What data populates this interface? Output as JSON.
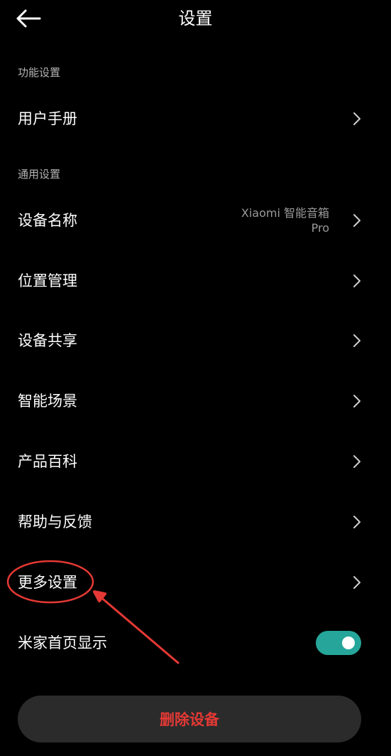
{
  "header": {
    "title": "设置",
    "back_icon": "arrow-left-icon"
  },
  "sections": {
    "function_label": "功能设置",
    "general_label": "通用设置"
  },
  "items": {
    "user_manual": "用户手册",
    "device_name": "设备名称",
    "device_name_value": "Xiaomi 智能音箱 Pro",
    "location": "位置管理",
    "share": "设备共享",
    "scenes": "智能场景",
    "encyclopedia": "产品百科",
    "help": "帮助与反馈",
    "more": "更多设置",
    "homepage_display": "米家首页显示"
  },
  "toggle": {
    "homepage_display_on": true
  },
  "delete_button": "删除设备",
  "colors": {
    "background": "#000000",
    "toggle_on": "#26a69a",
    "delete_text": "#e53935",
    "annotation": "#e53935"
  }
}
